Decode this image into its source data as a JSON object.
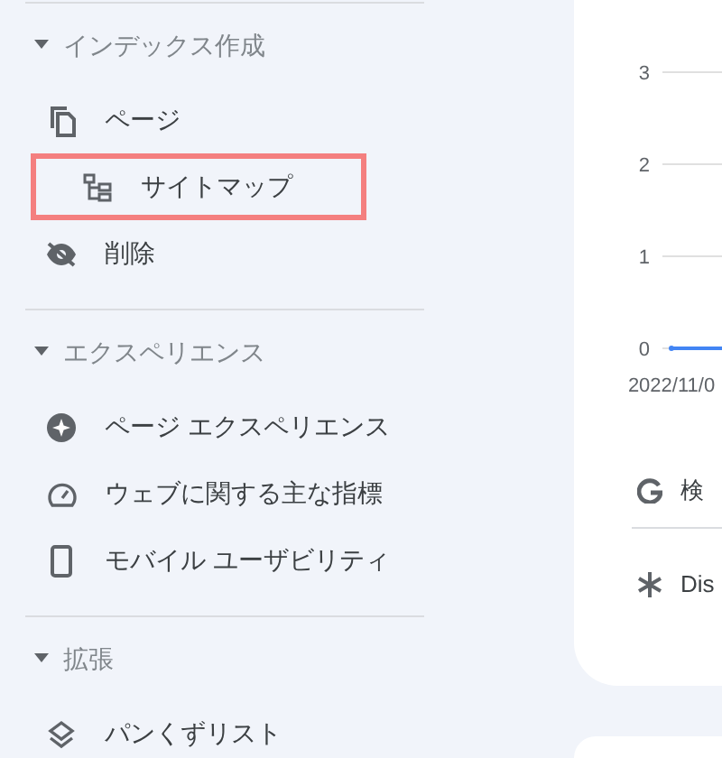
{
  "sidebar": {
    "sections": [
      {
        "title": "インデックス作成",
        "expanded": true,
        "items": [
          {
            "label": "ページ",
            "highlighted": false
          },
          {
            "label": "サイトマップ",
            "highlighted": true
          },
          {
            "label": "削除",
            "highlighted": false
          }
        ]
      },
      {
        "title": "エクスペリエンス",
        "expanded": true,
        "items": [
          {
            "label": "ページ エクスペリエンス",
            "highlighted": false
          },
          {
            "label": "ウェブに関する主な指標",
            "highlighted": false
          },
          {
            "label": "モバイル ユーザビリティ",
            "highlighted": false
          }
        ]
      },
      {
        "title": "拡張",
        "expanded": true,
        "items": [
          {
            "label": "パンくずリスト",
            "highlighted": false
          }
        ]
      }
    ]
  },
  "card": {
    "chart_data": {
      "type": "line",
      "categories": [
        "2022/11/0"
      ],
      "yticks": [
        0,
        1,
        2,
        3
      ],
      "ylim": [
        0,
        3
      ],
      "series": [
        {
          "color": "#4285f4",
          "marker": "circle",
          "values": [
            0
          ]
        }
      ]
    },
    "links": [
      {
        "label": "検"
      },
      {
        "label": "Dis"
      }
    ]
  }
}
